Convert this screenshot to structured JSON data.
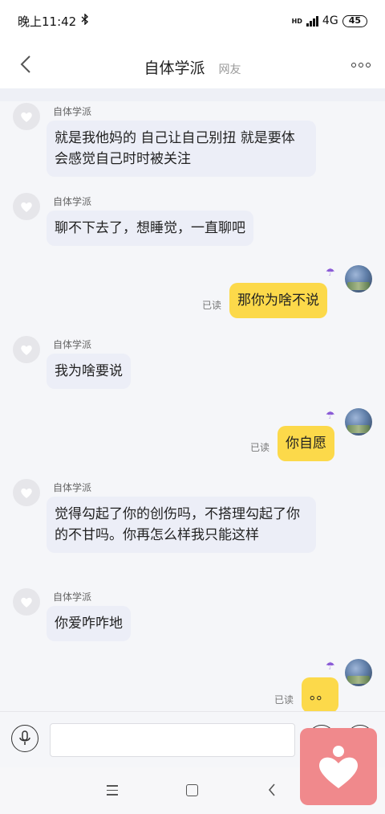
{
  "status_bar": {
    "time": "晚上11:42",
    "network": "4G",
    "hd": "HD",
    "battery": "45"
  },
  "header": {
    "title": "自体学派",
    "subtitle": "网友"
  },
  "messages": [
    {
      "side": "left",
      "sender": "自体学派",
      "text": "就是我他妈的 自己让自己别扭 就是要体会感觉自己时时被关注"
    },
    {
      "side": "left",
      "sender": "自体学派",
      "text": "聊不下去了，想睡觉，一直聊吧"
    },
    {
      "side": "right",
      "read": "已读",
      "text": "那你为啥不说"
    },
    {
      "side": "left",
      "sender": "自体学派",
      "text": "我为啥要说"
    },
    {
      "side": "right",
      "read": "已读",
      "text": "你自愿"
    },
    {
      "side": "left",
      "sender": "自体学派",
      "text": "觉得勾起了你的创伤吗，不搭理勾起了你的不甘吗。你再怎么样我只能这样"
    },
    {
      "side": "left",
      "sender": "自体学派",
      "text": "你爱咋咋地"
    },
    {
      "side": "right",
      "read": "已读",
      "text": "。。"
    }
  ],
  "input": {
    "value": "",
    "placeholder": ""
  },
  "colors": {
    "bubble_left": "#eceef7",
    "bubble_right": "#fcd94a",
    "chat_bg": "#f5f6f9",
    "float_app": "#f0898c"
  }
}
